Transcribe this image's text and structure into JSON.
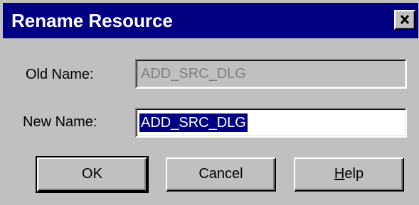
{
  "dialog": {
    "title": "Rename Resource",
    "close_glyph": "✕"
  },
  "fields": {
    "old_name_label": "Old Name:",
    "old_name_value": "ADD_SRC_DLG",
    "new_name_label": "New Name:",
    "new_name_value": "ADD_SRC_DLG"
  },
  "buttons": {
    "ok_label": "OK",
    "cancel_label": "Cancel",
    "help_label": "Help"
  },
  "colors": {
    "titlebar": "#000080",
    "face": "#c0c0c0",
    "selection": "#000080"
  }
}
